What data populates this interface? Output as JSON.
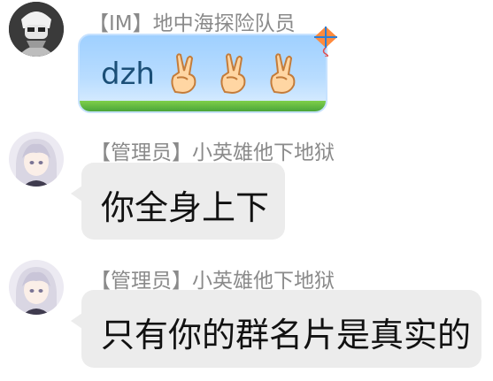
{
  "messages": [
    {
      "sender": "【IM】地中海探险队员",
      "text": "dzh",
      "emoji_name": "victory-hand-icon",
      "emoji_count": 3,
      "avatar_icon": "masked-character-avatar"
    },
    {
      "sender": "【管理员】小英雄他下地狱",
      "text": "你全身上下",
      "avatar_icon": "anime-girl-avatar"
    },
    {
      "sender": "【管理员】小英雄他下地狱",
      "text": "只有你的群名片是真实的",
      "avatar_icon": "anime-girl-avatar"
    }
  ],
  "colors": {
    "sender_text": "#8a8a8a",
    "bubble_gray": "#ececec",
    "bubble_blue": "#b8dcff",
    "bubble_blue_text": "#1b4f77"
  }
}
